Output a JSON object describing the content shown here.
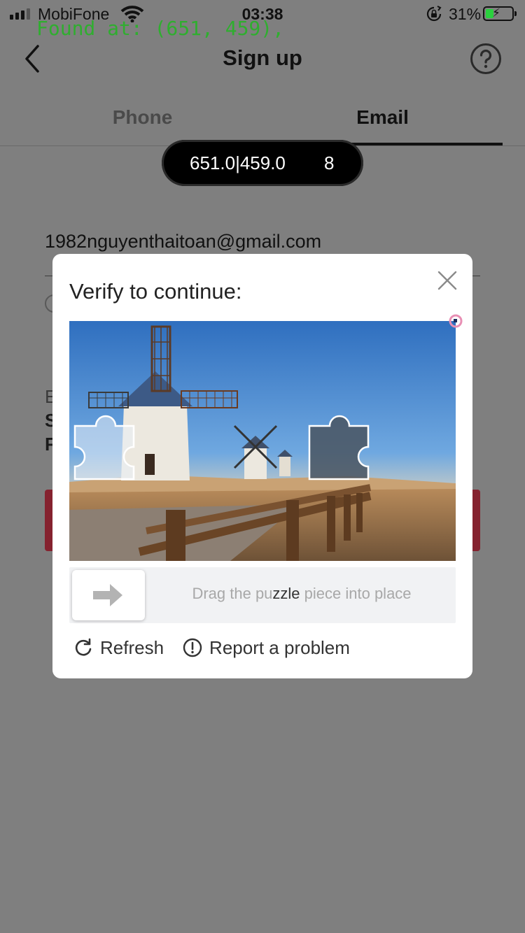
{
  "status_bar": {
    "carrier": "MobiFone",
    "time": "03:38",
    "battery_percent": "31%",
    "battery_level": 0.31,
    "icons": [
      "signal-icon",
      "wifi-icon",
      "rotation-lock-icon",
      "battery-icon"
    ]
  },
  "overlay": {
    "found_text": "Found at: (651, 459),"
  },
  "nav": {
    "title": "Sign up",
    "back_icon": "chevron-left-icon",
    "help_icon": "question-circle-icon"
  },
  "tabs": {
    "items": [
      {
        "label": "Phone",
        "active": false
      },
      {
        "label": "Email",
        "active": true
      }
    ]
  },
  "coord_pill": {
    "coords": "651.0|459.0",
    "count": "8"
  },
  "form": {
    "email_value": "1982nguyenthaitoan@gmail.com",
    "fragments": [
      "E",
      "S",
      "F"
    ]
  },
  "captcha": {
    "title": "Verify to continue:",
    "close_icon": "close-icon",
    "slider_text_before": "Drag the pu",
    "slider_text_highlight": "zzle",
    "slider_text_after": " piece into place",
    "slider_icon": "arrow-right-icon",
    "refresh_label": "Refresh",
    "report_label": "Report a problem",
    "refresh_icon": "refresh-icon",
    "report_icon": "exclamation-circle-icon"
  },
  "colors": {
    "overlay_bg": "#7f7f7f",
    "primary_button": "#85222f",
    "overlay_text": "#2fae2f",
    "battery_fill": "#2ad13e",
    "marker": "#e88fb4"
  }
}
